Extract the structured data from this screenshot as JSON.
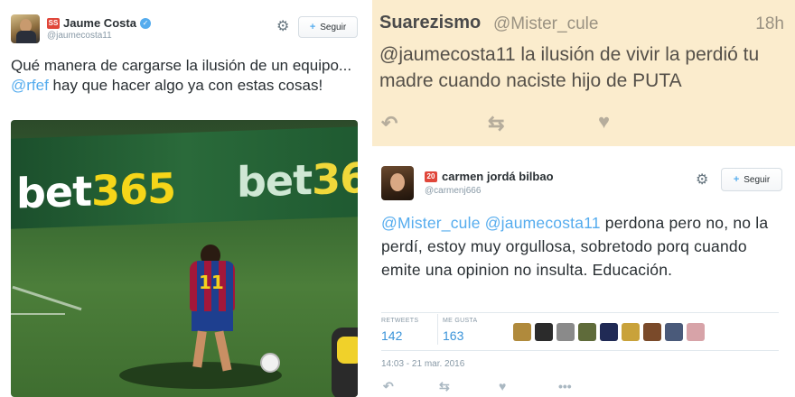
{
  "left_tweet": {
    "badge": "SS",
    "name": "Jaume Costa",
    "handle": "@jaumecosta11",
    "follow_label": "Seguir",
    "text_before": "Qué manera de cargarse la ilusión de un equipo... ",
    "mention": "@rfef",
    "text_after": " hay que hacer algo ya con estas cosas!",
    "photo": {
      "board_text_1_white": "bet",
      "board_text_1_yellow": "365",
      "board_text_2_white": "bet",
      "board_text_2_yellow": "36",
      "shirt_number": "11"
    }
  },
  "reply_yellow": {
    "name": "Suarezismo",
    "handle": "@Mister_cule",
    "time": "18h",
    "text": "@jaumecosta11 la ilusión de vivir la perdió tu madre cuando naciste hijo de PUTA",
    "actions": {
      "reply_icon": "reply-icon",
      "retweet_icon": "retweet-icon",
      "like_icon": "heart-icon"
    }
  },
  "reply_white": {
    "badge": "20",
    "name": "carmen jordá bilbao",
    "handle": "@carmenj666",
    "follow_label": "Seguir",
    "mention_1": "@Mister_cule",
    "mention_2": "@jaumecosta11",
    "text": " perdona pero no, no la perdí, estoy muy orgullosa, sobretodo porq cuando emite una opinion no insulta. Educación.",
    "retweets_label": "RETWEETS",
    "retweets_value": "142",
    "likes_label": "ME GUSTA",
    "likes_value": "163",
    "timestamp": "14:03 - 21 mar. 2016",
    "mini_avatar_colors": [
      "#b08a3c",
      "#2b2b2b",
      "#8a8a8a",
      "#5f6b3a",
      "#202a55",
      "#c9a23a",
      "#7a4a2a",
      "#4a5a7a",
      "#d7a3a8"
    ]
  },
  "colors": {
    "twitter_blue": "#55acee",
    "yellow_bg": "#fbeccd",
    "text_dark": "#292f33",
    "text_muted": "#8899a6"
  }
}
